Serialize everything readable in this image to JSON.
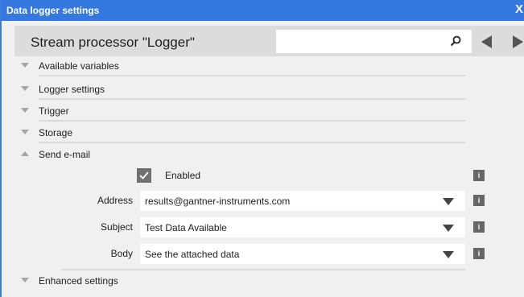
{
  "window": {
    "title": "Data logger settings",
    "close_glyph": "X"
  },
  "header": {
    "title": "Stream processor \"Logger\"",
    "search_value": ""
  },
  "sections": {
    "available_variables": "Available variables",
    "logger_settings": "Logger settings",
    "trigger": "Trigger",
    "storage": "Storage",
    "send_email": "Send e-mail",
    "enhanced_settings": "Enhanced settings"
  },
  "send_email": {
    "enabled_label": "Enabled",
    "enabled": true,
    "address_label": "Address",
    "address_value": "results@gantner-instruments.com",
    "subject_label": "Subject",
    "subject_value": "Test Data Available",
    "body_label": "Body",
    "body_value": "See the attached data"
  },
  "info_glyph": "i",
  "colors": {
    "titlebar": "#3478e0",
    "header": "#dcdcdc",
    "panel": "#f0f0f0"
  }
}
